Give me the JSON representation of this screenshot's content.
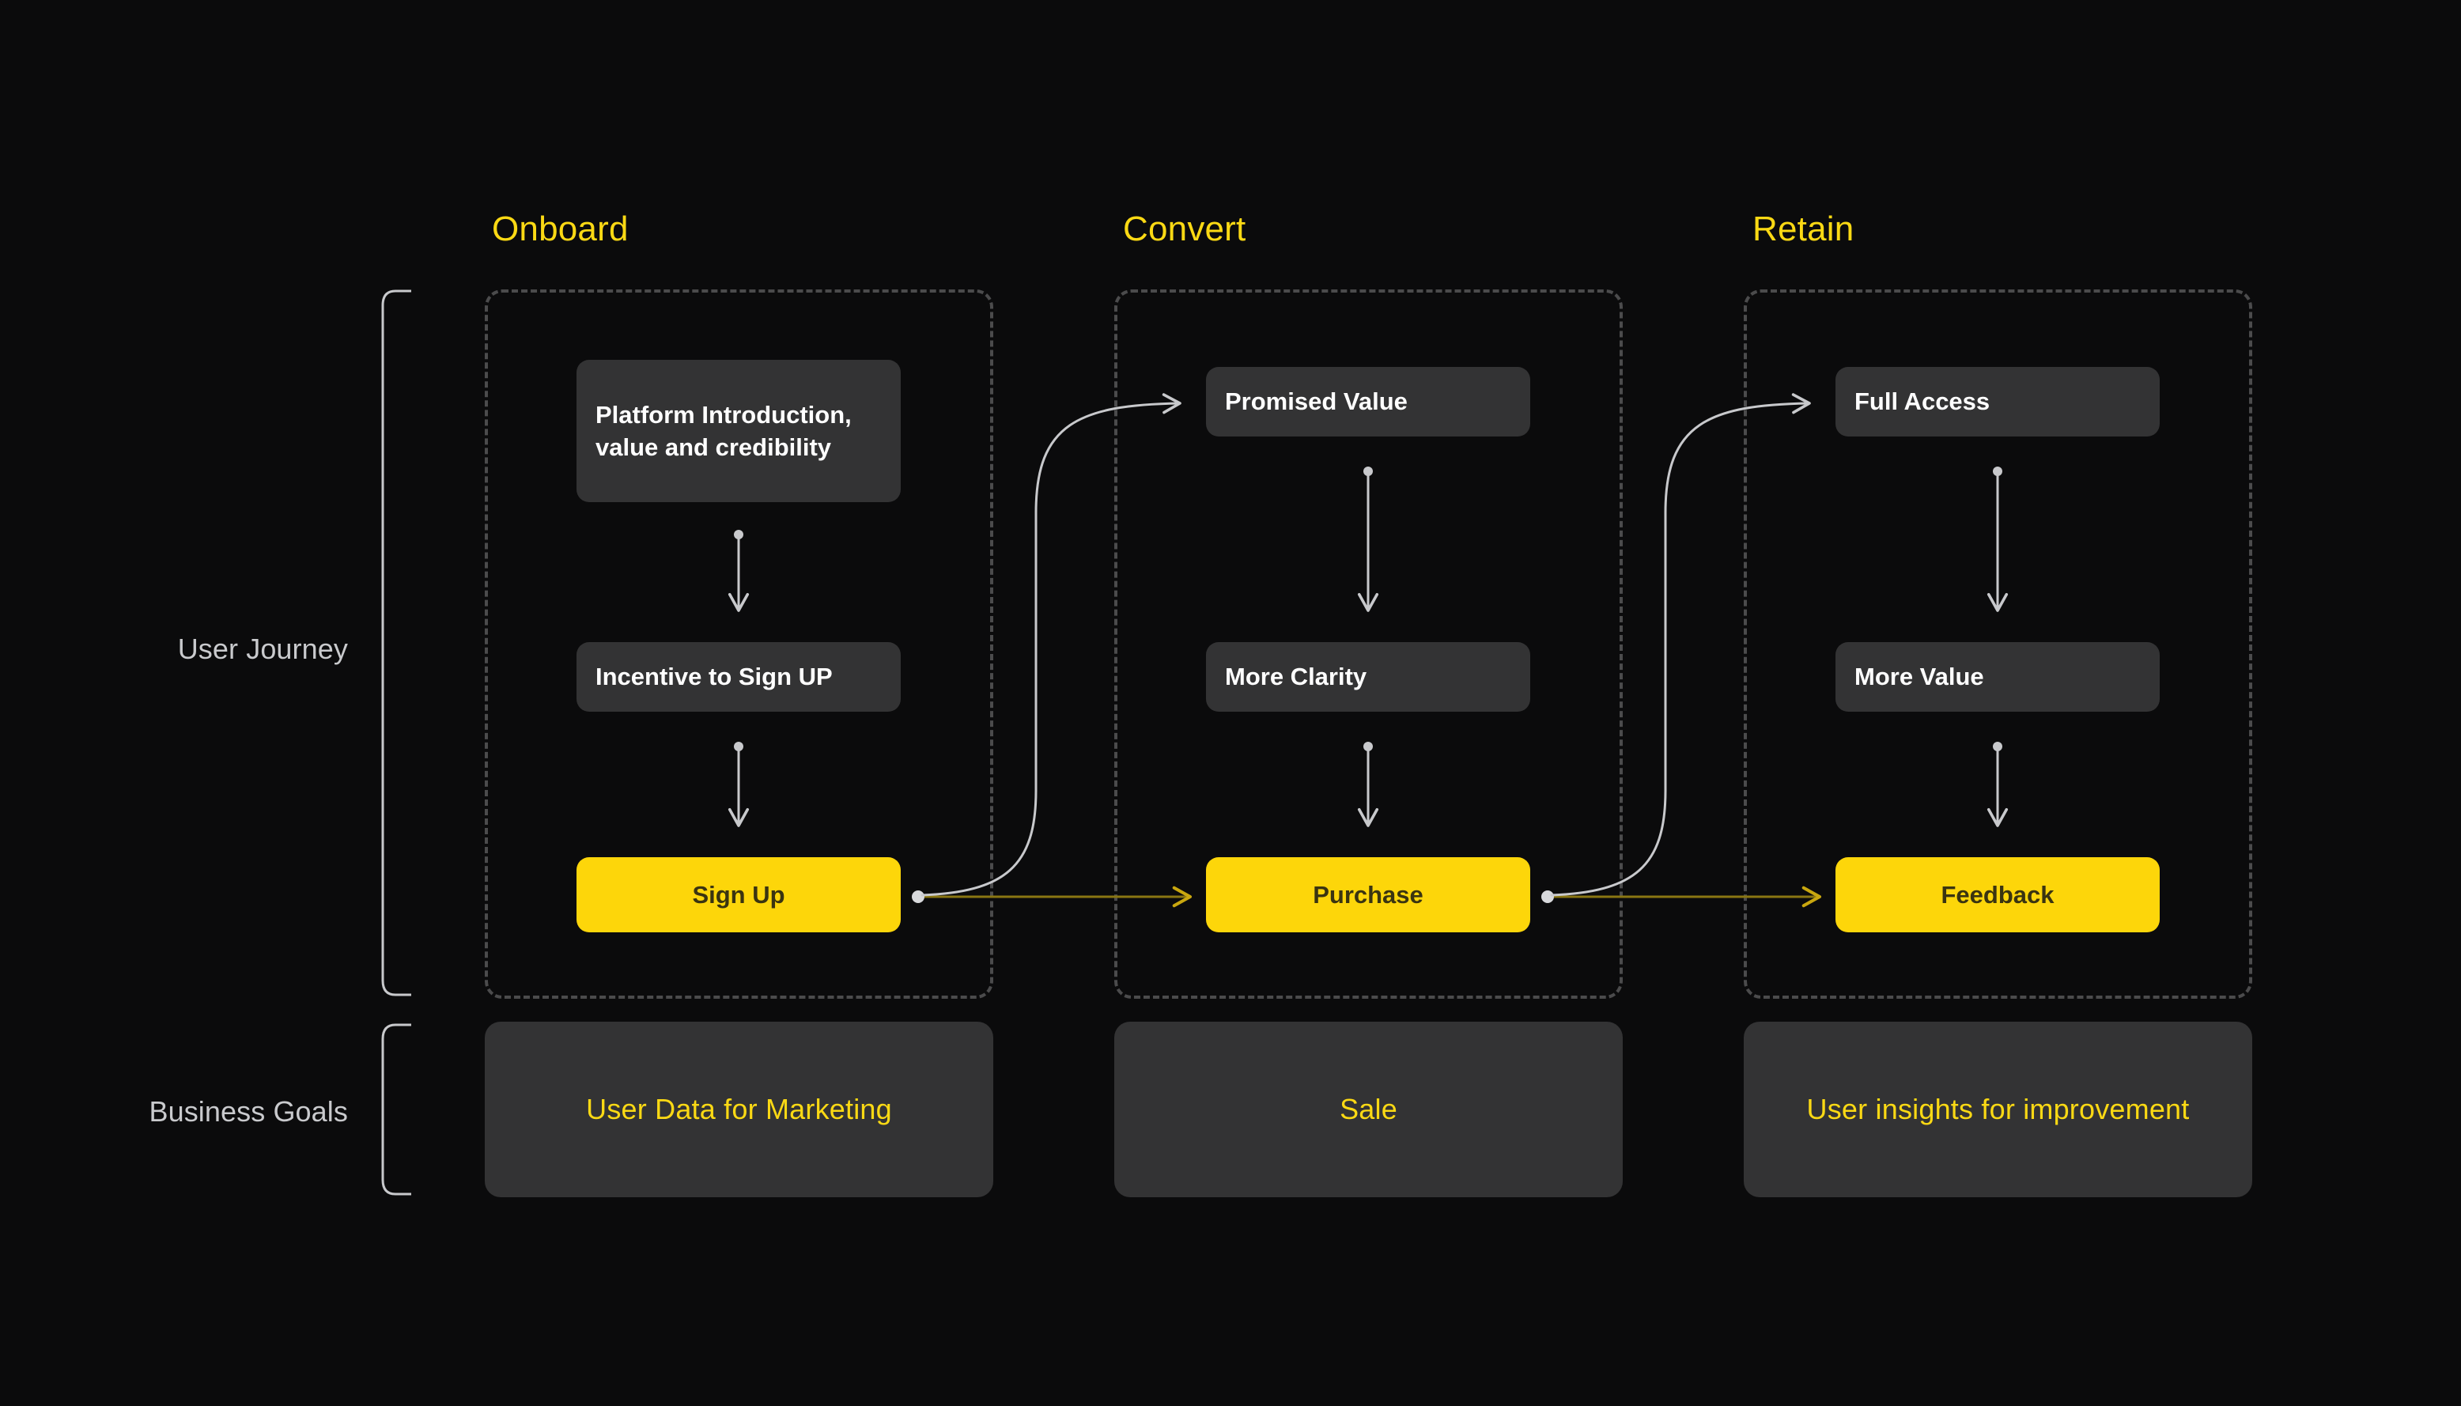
{
  "canvas": {
    "background": "#0b0b0c",
    "accent": "#fbd914",
    "cta_fill": "#fdd60a",
    "card_fill": "#333334",
    "dashed_border": "#4b4b4c",
    "connector_light": "#c8c9cc",
    "connector_amber": "#8a7612"
  },
  "rows": [
    {
      "id": "user-journey",
      "label": "User Journey"
    },
    {
      "id": "business-goals",
      "label": "Business Goals"
    }
  ],
  "columns": [
    {
      "id": "onboard",
      "header": "Onboard",
      "steps": [
        {
          "id": "platform-introduction",
          "label": "Platform Introduction, value and credibility",
          "kind": "card"
        },
        {
          "id": "incentive-to-sign-up",
          "label": "Incentive to Sign UP",
          "kind": "card"
        },
        {
          "id": "sign-up",
          "label": "Sign Up",
          "kind": "cta"
        }
      ],
      "goal": "User Data for Marketing"
    },
    {
      "id": "convert",
      "header": "Convert",
      "steps": [
        {
          "id": "promised-value",
          "label": "Promised Value",
          "kind": "card"
        },
        {
          "id": "more-clarity",
          "label": "More Clarity",
          "kind": "card"
        },
        {
          "id": "purchase",
          "label": "Purchase",
          "kind": "cta"
        }
      ],
      "goal": "Sale"
    },
    {
      "id": "retain",
      "header": "Retain",
      "steps": [
        {
          "id": "full-access",
          "label": "Full Access",
          "kind": "card"
        },
        {
          "id": "more-value",
          "label": "More Value",
          "kind": "card"
        },
        {
          "id": "feedback",
          "label": "Feedback",
          "kind": "cta"
        }
      ],
      "goal": "User insights for improvement"
    }
  ]
}
